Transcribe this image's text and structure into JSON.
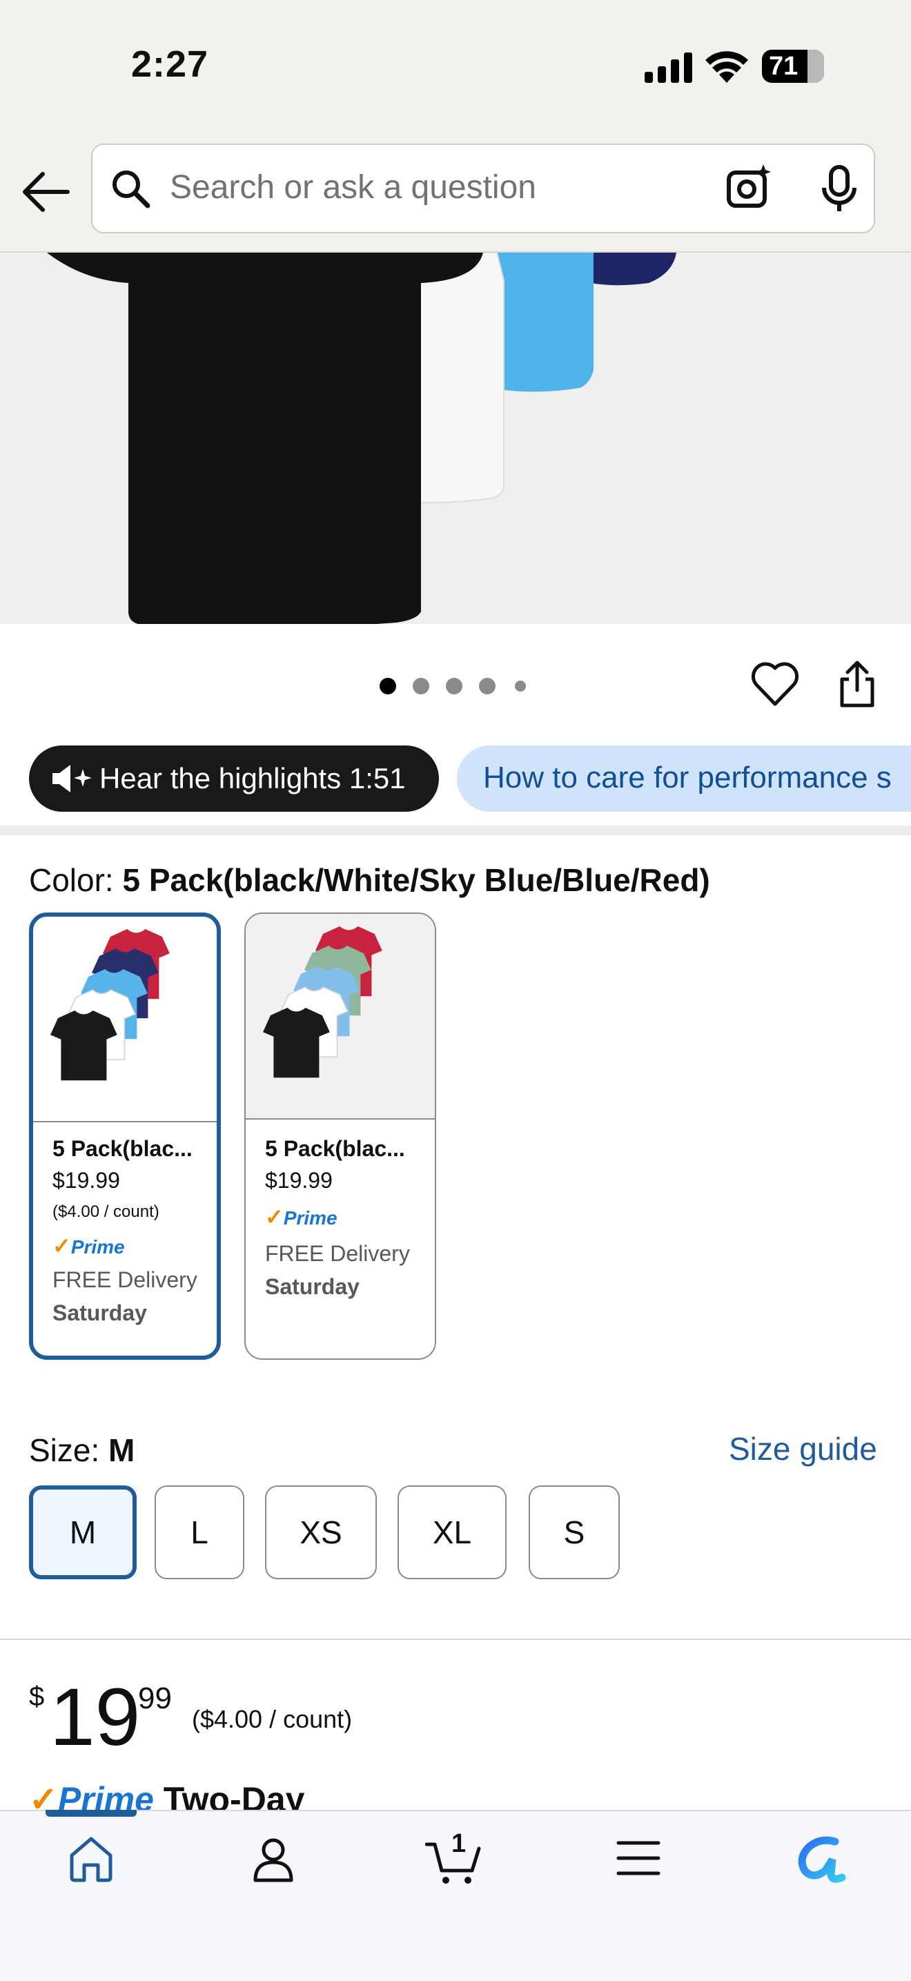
{
  "status": {
    "time": "2:27",
    "battery": "71"
  },
  "search": {
    "placeholder": "Search or ask a question"
  },
  "gallery": {
    "dot_count": 5,
    "active_dot": 0
  },
  "highlights": {
    "hear_label": "Hear the highlights 1:51",
    "care_label": "How to care for performance s"
  },
  "color": {
    "label": "Color: ",
    "selected": "5 Pack(black/White/Sky Blue/Blue/Red)",
    "options": [
      {
        "name": "5 Pack(blac...",
        "price": "$19.99",
        "unit": "($4.00 / count)",
        "prime": "Prime",
        "delivery": "FREE Delivery",
        "day": "Saturday",
        "shirts": [
          "#c8233e",
          "#27306b",
          "#56b4ea",
          "#ffffff",
          "#1a1a1a"
        ]
      },
      {
        "name": "5 Pack(blac...",
        "price": "$19.99",
        "prime": "Prime",
        "delivery": "FREE Delivery",
        "day": "Saturday",
        "shirts": [
          "#c8233e",
          "#8fb79b",
          "#83bde9",
          "#ffffff",
          "#1a1a1a"
        ]
      }
    ]
  },
  "size": {
    "label": "Size: ",
    "selected": "M",
    "guide": "Size guide",
    "options": [
      "M",
      "L",
      "XS",
      "XL",
      "S"
    ]
  },
  "price": {
    "symbol": "$",
    "whole": "19",
    "fraction": "99",
    "unit": "($4.00 / count)"
  },
  "shipping_teaser": {
    "prime": "Prime",
    "text": "Two-Day"
  },
  "nav": {
    "cart_count": "1",
    "tabs": [
      "home-icon",
      "account-icon",
      "cart-icon",
      "menu-icon",
      "rufus-icon"
    ]
  },
  "colors": {
    "accent": "#1f5c99",
    "prime_blue": "#1a75d2",
    "prime_check": "#f08804"
  }
}
